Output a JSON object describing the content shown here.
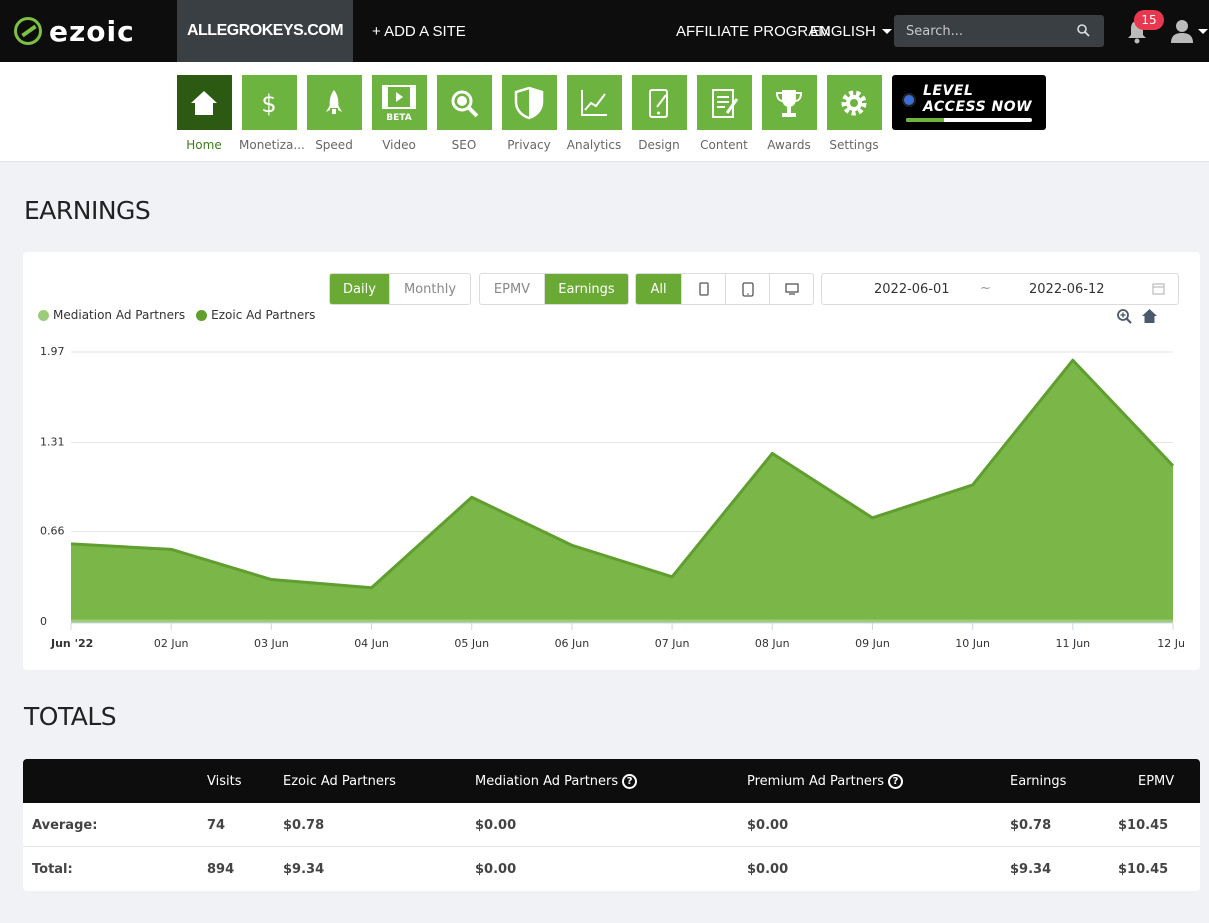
{
  "header": {
    "logo_text": "ezoic",
    "site": "ALLEGROKEYS.COM",
    "add_site": "+ ADD A SITE",
    "affiliate": "AFFILIATE PROGRAM",
    "language": "ENGLISH",
    "search_placeholder": "Search...",
    "notifications": "15",
    "icons": [
      "search-icon",
      "bell-icon",
      "user-icon",
      "chevron-down-icon"
    ]
  },
  "nav": {
    "items": [
      {
        "label": "Home",
        "icon": "home-icon",
        "active": true
      },
      {
        "label": "Monetiza...",
        "icon": "dollar-icon"
      },
      {
        "label": "Speed",
        "icon": "rocket-icon"
      },
      {
        "label": "Video",
        "icon": "video-icon",
        "tag": "BETA"
      },
      {
        "label": "SEO",
        "icon": "magnifier-icon"
      },
      {
        "label": "Privacy",
        "icon": "shield-icon"
      },
      {
        "label": "Analytics",
        "icon": "line-chart-icon"
      },
      {
        "label": "Design",
        "icon": "design-icon"
      },
      {
        "label": "Content",
        "icon": "document-icon"
      },
      {
        "label": "Awards",
        "icon": "trophy-icon"
      },
      {
        "label": "Settings",
        "icon": "gear-icon"
      }
    ],
    "level_banner": {
      "line1": "LEVEL",
      "line2": "ACCESS NOW",
      "progress": 0.3
    }
  },
  "earnings": {
    "heading": "EARNINGS",
    "period_buttons": [
      "Daily",
      "Monthly"
    ],
    "period_selected": "Daily",
    "metric_buttons": [
      "EPMV",
      "Earnings"
    ],
    "metric_selected": "Earnings",
    "device_all": "All",
    "device_icons": [
      "mobile-icon",
      "tablet-icon",
      "desktop-icon"
    ],
    "date_from": "2022-06-01",
    "date_separator": "~",
    "date_to": "2022-06-12",
    "tool_icons": [
      "zoom-icon",
      "home-reset-icon",
      "calendar-icon"
    ],
    "colors": {
      "accent": "#6aa933",
      "mediation": "#9ccc7a",
      "ezoic": "#5f9e2f",
      "area": "#7ab648"
    }
  },
  "chart_data": {
    "type": "area",
    "x": [
      "Jun '22",
      "02 Jun",
      "03 Jun",
      "04 Jun",
      "05 Jun",
      "06 Jun",
      "07 Jun",
      "08 Jun",
      "09 Jun",
      "10 Jun",
      "11 Jun",
      "12 Ju"
    ],
    "series": [
      {
        "name": "Mediation Ad Partners",
        "values": [
          0,
          0,
          0,
          0,
          0,
          0,
          0,
          0,
          0,
          0,
          0,
          0
        ]
      },
      {
        "name": "Ezoic Ad Partners",
        "values": [
          0.57,
          0.53,
          0.31,
          0.25,
          0.91,
          0.56,
          0.33,
          1.23,
          0.76,
          1.0,
          1.91,
          1.14
        ]
      }
    ],
    "yticks": [
      "1.97",
      "1.31",
      "0.66",
      "0"
    ],
    "ylim": [
      0,
      1.97
    ],
    "grid": true,
    "legend": "top-left"
  },
  "totals": {
    "heading": "TOTALS",
    "columns": [
      "",
      "Visits",
      "Ezoic Ad Partners",
      "Mediation Ad Partners",
      "Premium Ad Partners",
      "Earnings",
      "EPMV"
    ],
    "help_icon": "?",
    "rows": [
      [
        "Average:",
        "74",
        "$0.78",
        "$0.00",
        "$0.00",
        "$0.78",
        "$10.45"
      ],
      [
        "Total:",
        "894",
        "$9.34",
        "$0.00",
        "$0.00",
        "$9.34",
        "$10.45"
      ]
    ]
  }
}
